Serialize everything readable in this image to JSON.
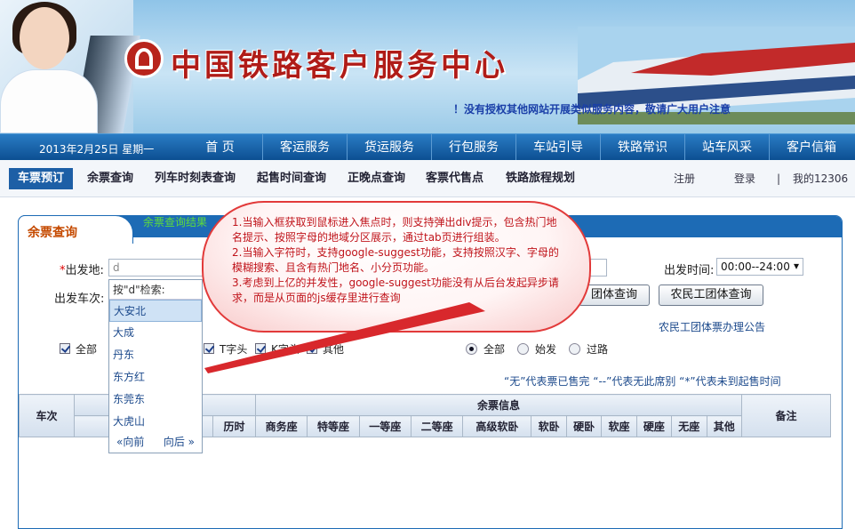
{
  "banner": {
    "site_title": "中国铁路客户服务中心",
    "notice_mark": "！",
    "notice_text": "没有授权其他网站开展类似服务内容，",
    "notice_highlight": "敬请广大用户注意"
  },
  "mainnav": {
    "date": "2013年2月25日  星期一",
    "items": [
      "首 页",
      "客运服务",
      "货运服务",
      "行包服务",
      "车站引导",
      "铁路常识",
      "站车风采",
      "客户信箱"
    ]
  },
  "subnav": {
    "items": [
      "车票预订",
      "余票查询",
      "列车时刻表查询",
      "起售时间查询",
      "正晚点查询",
      "客票代售点",
      "铁路旅程规划"
    ],
    "register": "注册",
    "login": "登录",
    "divider": "|",
    "my": "我的12306"
  },
  "panel": {
    "tab_active": "余票查询",
    "tab_result": "余票查询结果",
    "from_label": "出发地:",
    "from_required": "*",
    "from_value": "d",
    "depart_label": "出发车次:",
    "time_label": "出发时间:",
    "time_value": "00:00--24:00",
    "group_btn": "团体查询",
    "migrant_btn": "农民工团体查询",
    "migrant_notice": "农民工团体票办理公告",
    "checkboxes": [
      "全部",
      "T字头",
      "K字头",
      "其他"
    ],
    "radios": [
      "全部",
      "始发",
      "过路"
    ],
    "legend": "“无”代表票已售完  “--”代表无此席别  “*”代表未到起售时间"
  },
  "table": {
    "col_train": "车次",
    "col_time_tail": "间",
    "col_avail": "余票信息",
    "col_note": "备注",
    "sub_station_tail": "站",
    "sub_duration": "历时",
    "seats": [
      "商务座",
      "特等座",
      "一等座",
      "二等座",
      "高级软卧",
      "软卧",
      "硬卧",
      "软座",
      "硬座",
      "无座",
      "其他"
    ]
  },
  "suggest": {
    "header": "按\"d\"检索:",
    "items": [
      "大安北",
      "大成",
      "丹东",
      "东方红",
      "东莞东",
      "大虎山"
    ],
    "prev": "«向前",
    "next": "向后 »"
  },
  "annotation": {
    "lines": [
      "1.当输入框获取到鼠标进入焦点时，则支持弹出div提示，包含热门地名提示、按照字母的地域分区展示，通过tab页进行组装。",
      "2.当输入字符时，支持google-suggest功能，支持按照汉字、字母的模糊搜索、且含有热门地名、小分页功能。",
      "3.考虑到上亿的并发性，google-suggest功能没有从后台发起异步请求，而是从页面的js缓存里进行查询"
    ]
  }
}
